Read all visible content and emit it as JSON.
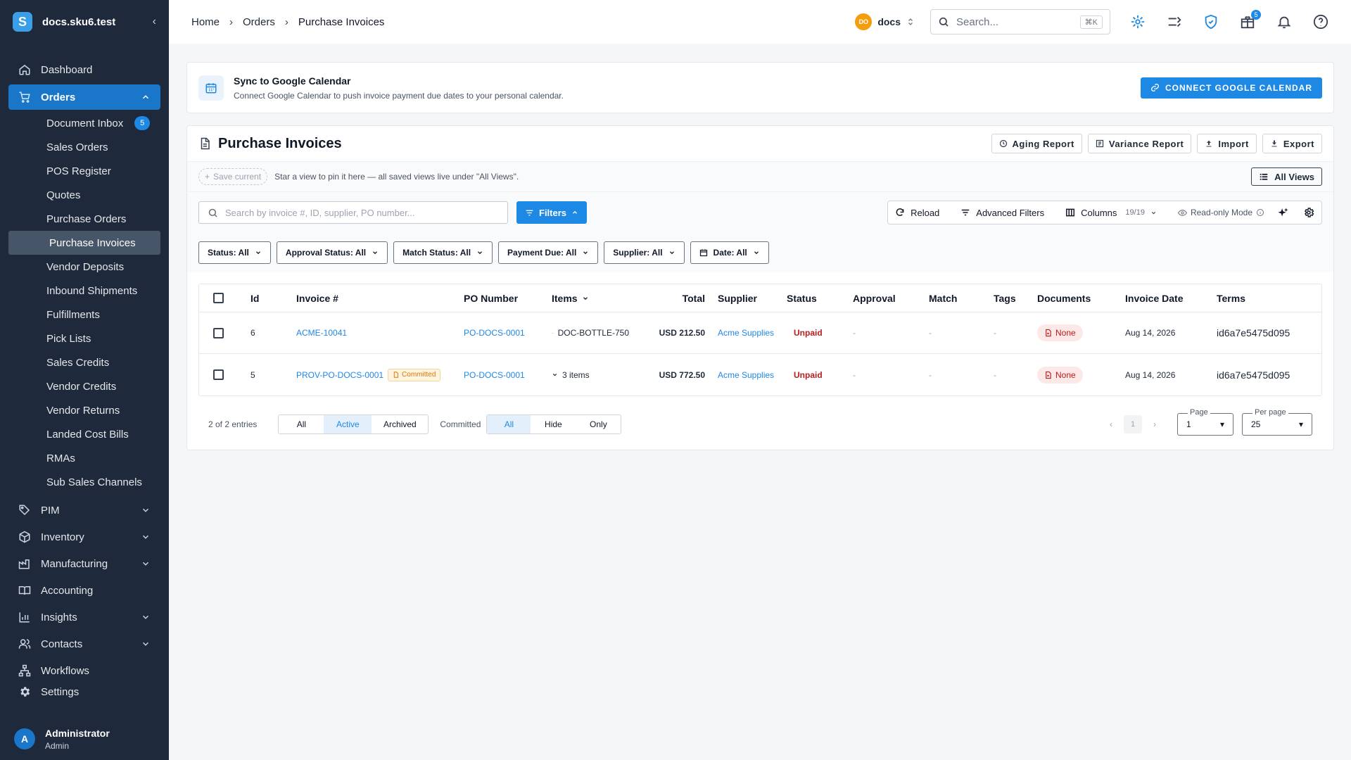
{
  "sidebar": {
    "workspace": "docs.sku6.test",
    "top_items": [
      {
        "label": "Dashboard"
      }
    ],
    "orders": {
      "label": "Orders",
      "items": [
        {
          "label": "Document Inbox",
          "badge": "5"
        },
        {
          "label": "Sales Orders"
        },
        {
          "label": "POS Register"
        },
        {
          "label": "Quotes"
        },
        {
          "label": "Purchase Orders"
        },
        {
          "label": "Purchase Invoices"
        },
        {
          "label": "Vendor Deposits"
        },
        {
          "label": "Inbound Shipments"
        },
        {
          "label": "Fulfillments"
        },
        {
          "label": "Pick Lists"
        },
        {
          "label": "Sales Credits"
        },
        {
          "label": "Vendor Credits"
        },
        {
          "label": "Vendor Returns"
        },
        {
          "label": "Landed Cost Bills"
        },
        {
          "label": "RMAs"
        },
        {
          "label": "Sub Sales Channels"
        }
      ]
    },
    "groups": [
      {
        "label": "PIM"
      },
      {
        "label": "Inventory"
      },
      {
        "label": "Manufacturing"
      },
      {
        "label": "Accounting"
      },
      {
        "label": "Insights"
      },
      {
        "label": "Contacts"
      },
      {
        "label": "Workflows"
      }
    ],
    "settings": "Settings",
    "user": {
      "initial": "A",
      "name": "Administrator",
      "role": "Admin"
    }
  },
  "topbar": {
    "breadcrumbs": [
      "Home",
      "Orders",
      "Purchase Invoices"
    ],
    "org": {
      "initials": "DO",
      "name": "docs"
    },
    "search_placeholder": "Search...",
    "search_shortcut": "⌘K",
    "gift_badge": "5"
  },
  "gcal": {
    "title": "Sync to Google Calendar",
    "description": "Connect Google Calendar to push invoice payment due dates to your personal calendar.",
    "button": "CONNECT GOOGLE CALENDAR"
  },
  "page": {
    "title": "Purchase Invoices",
    "actions": [
      "Aging Report",
      "Variance Report",
      "Import",
      "Export"
    ],
    "save_current": "Save current",
    "views_hint": "Star a view to pin it here — all saved views live under \"All Views\".",
    "all_views": "All Views",
    "search_placeholder": "Search by invoice #, ID, supplier, PO number...",
    "filters": "Filters",
    "toolbar": {
      "reload": "Reload",
      "advanced": "Advanced Filters",
      "columns": "Columns",
      "columns_count": "19/19",
      "readonly": "Read-only Mode"
    },
    "chips": [
      "Status: All",
      "Approval Status: All",
      "Match Status: All",
      "Payment Due: All",
      "Supplier: All",
      "Date: All"
    ]
  },
  "table": {
    "columns": [
      "Id",
      "Invoice #",
      "PO Number",
      "Items",
      "Total",
      "Supplier",
      "Status",
      "Approval",
      "Match",
      "Tags",
      "Documents",
      "Invoice Date",
      "Terms"
    ],
    "rows": [
      {
        "id": "6",
        "invoice": "ACME-10041",
        "committed": "",
        "po": "PO-DOCS-0001",
        "items": "DOC-BOTTLE-750",
        "total": "USD 212.50",
        "supplier": "Acme Supplies",
        "status": "Unpaid",
        "approval": "-",
        "match": "-",
        "tags": "-",
        "documents": "None",
        "date": "Aug 14, 2026",
        "terms": "id6a7e5475d095"
      },
      {
        "id": "5",
        "invoice": "PROV-PO-DOCS-0001",
        "committed": "Committed",
        "po": "PO-DOCS-0001",
        "items": "3 items",
        "total": "USD 772.50",
        "supplier": "Acme Supplies",
        "status": "Unpaid",
        "approval": "-",
        "match": "-",
        "tags": "-",
        "documents": "None",
        "date": "Aug 14, 2026",
        "terms": "id6a7e5475d095"
      }
    ]
  },
  "footer": {
    "entries": "2 of 2 entries",
    "archive_filter": [
      "All",
      "Active",
      "Archived"
    ],
    "committed_label": "Committed",
    "committed_filter": [
      "All",
      "Hide",
      "Only"
    ],
    "current_page": "1",
    "page_label": "Page",
    "page_value": "1",
    "per_page_label": "Per page",
    "per_page_value": "25"
  }
}
